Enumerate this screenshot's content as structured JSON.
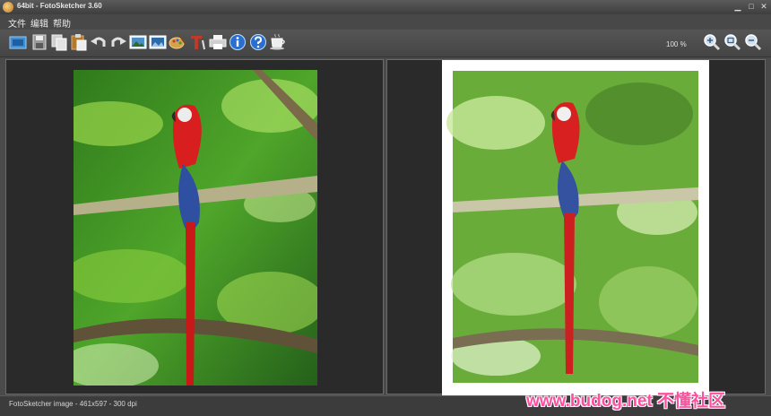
{
  "window": {
    "title": "64bit - FotoSketcher 3.60",
    "minimize_glyph": "▁",
    "maximize_glyph": "□",
    "close_glyph": "✕"
  },
  "menu": {
    "items": [
      {
        "label": "文件"
      },
      {
        "label": "编辑"
      },
      {
        "label": "帮助"
      }
    ]
  },
  "toolbar": {
    "zoom_level": "100 %",
    "buttons": [
      {
        "name": "open-icon",
        "color": "#3d8fd8"
      },
      {
        "name": "save-icon",
        "color": "#bfbfbf"
      },
      {
        "name": "copy-icon",
        "color": "#d9d9d9"
      },
      {
        "name": "paste-icon",
        "color": "#c08a3a"
      },
      {
        "name": "undo-icon",
        "color": "#e0e0e0"
      },
      {
        "name": "redo-icon",
        "color": "#e0e0e0"
      },
      {
        "name": "original-image-icon",
        "color": "#4a90c8"
      },
      {
        "name": "result-image-icon",
        "color": "#4a90c8"
      },
      {
        "name": "palette-icon",
        "color": "#d8a24a"
      },
      {
        "name": "text-tool-icon",
        "color": "#c0392b"
      },
      {
        "name": "print-icon",
        "color": "#d9d9d9"
      },
      {
        "name": "info-icon",
        "color": "#2a6fd0"
      },
      {
        "name": "help-icon",
        "color": "#2a6fd0"
      },
      {
        "name": "coffee-icon",
        "color": "#e8e8e8"
      },
      {
        "name": "zoom-in-icon",
        "color": "#9fb7d0"
      },
      {
        "name": "zoom-fit-icon",
        "color": "#9fb7d0"
      },
      {
        "name": "zoom-out-icon",
        "color": "#9fb7d0"
      }
    ]
  },
  "status": {
    "text": "FotoSketcher image - 461x597 - 300 dpi"
  },
  "watermark": {
    "text": "www.budog.net 不懂社区"
  },
  "colors": {
    "parrot_red": "#d81e1e",
    "parrot_blue": "#2f4fa0",
    "foliage": "#3f9a2a",
    "foliage_light": "#9ad64a",
    "frame": "#ffffff",
    "branch": "#8a7a55"
  }
}
